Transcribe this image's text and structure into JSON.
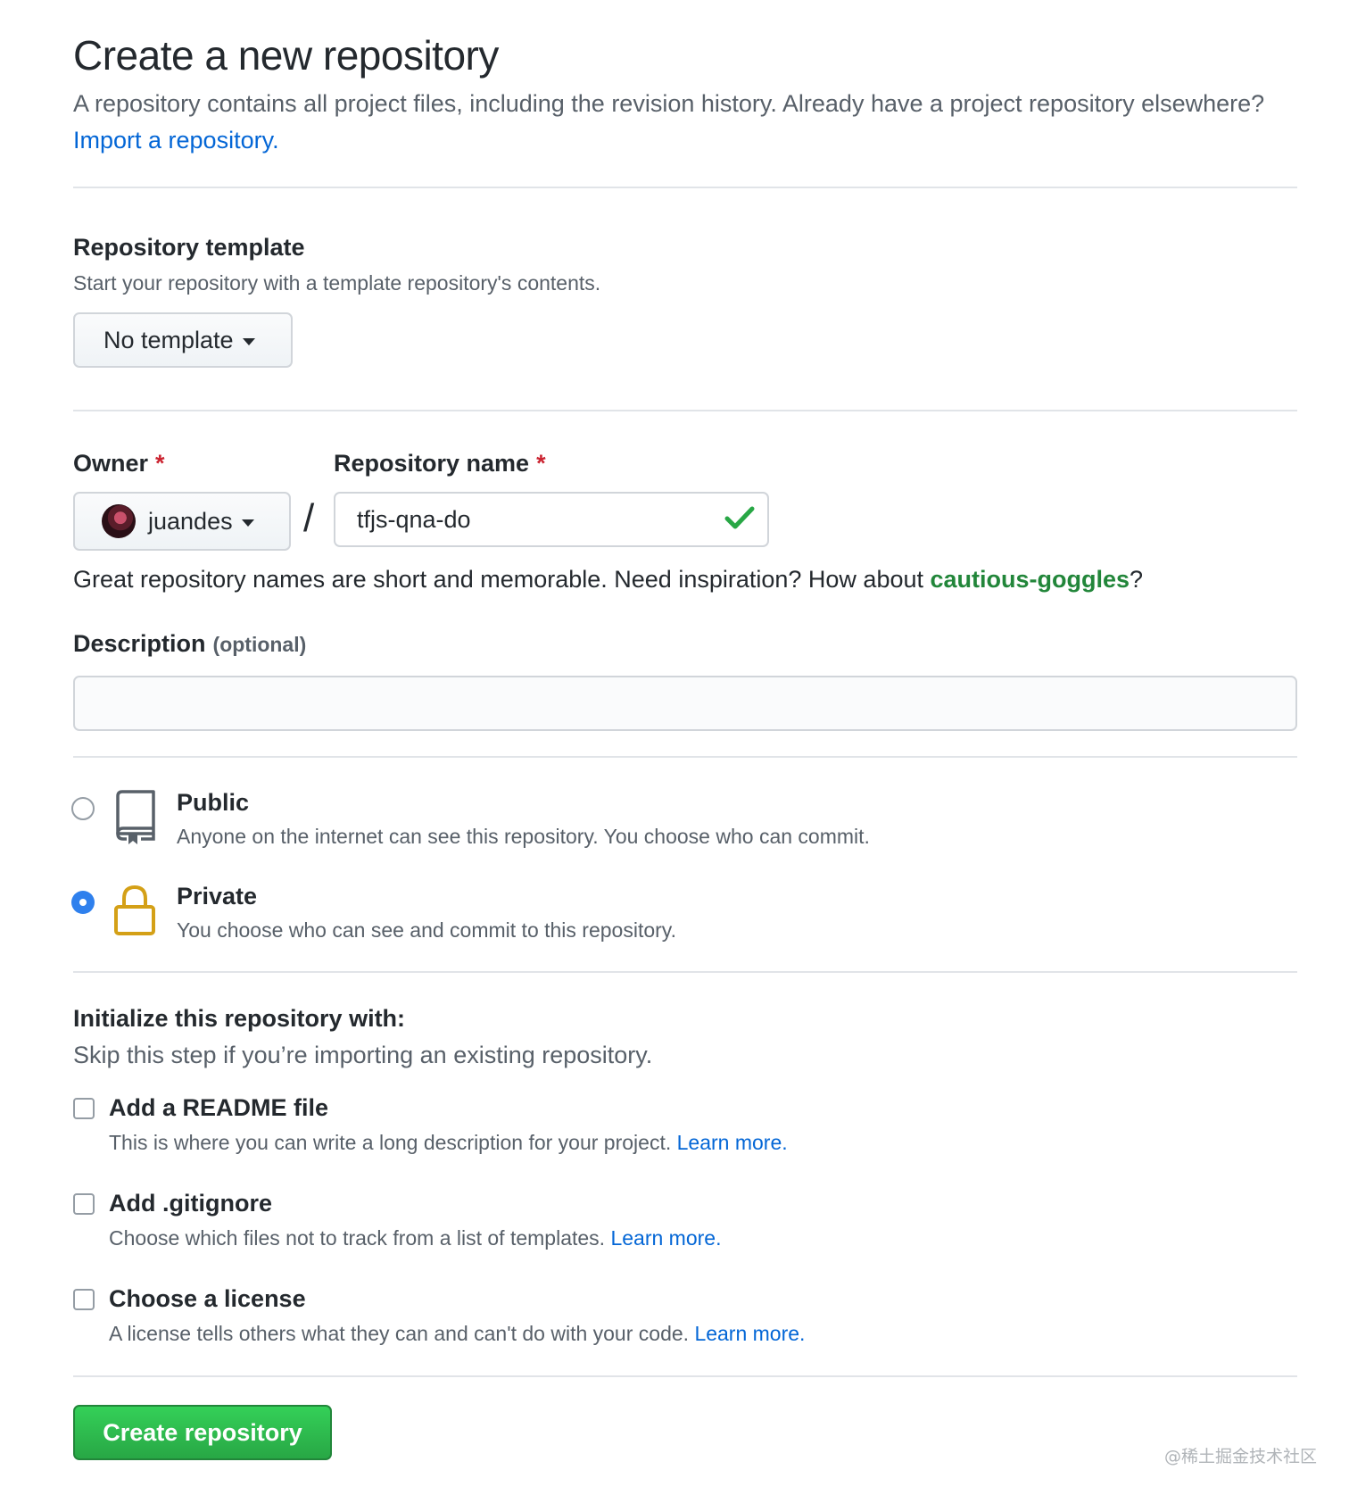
{
  "header": {
    "title": "Create a new repository",
    "subtitle_text": "A repository contains all project files, including the revision history. Already have a project repository elsewhere?",
    "import_link": "Import a repository."
  },
  "template": {
    "heading": "Repository template",
    "note": "Start your repository with a template repository's contents.",
    "button_label": "No template"
  },
  "owner": {
    "label": "Owner",
    "required_mark": "*",
    "value": "juandes"
  },
  "repo_name": {
    "label": "Repository name",
    "required_mark": "*",
    "slash": "/",
    "value": "tfjs-qna-do",
    "valid_icon": "check-icon",
    "valid_color": "#28a745"
  },
  "name_hint": {
    "text": "Great repository names are short and memorable. Need inspiration? How about",
    "suggestion": "cautious-goggles",
    "suffix": "?"
  },
  "description": {
    "label": "Description",
    "optional": "(optional)",
    "value": ""
  },
  "visibility": {
    "options": [
      {
        "title": "Public",
        "description": "Anyone on the internet can see this repository. You choose who can commit.",
        "icon": "repo-icon",
        "selected": false
      },
      {
        "title": "Private",
        "description": "You choose who can see and commit to this repository.",
        "icon": "lock-icon",
        "selected": true
      }
    ]
  },
  "initialize": {
    "heading": "Initialize this repository with:",
    "note": "Skip this step if you’re importing an existing repository.",
    "options": [
      {
        "title": "Add a README file",
        "description": "This is where you can write a long description for your project.",
        "learn_more": "Learn more.",
        "checked": false
      },
      {
        "title": "Add .gitignore",
        "description": "Choose which files not to track from a list of templates.",
        "learn_more": "Learn more.",
        "checked": false
      },
      {
        "title": "Choose a license",
        "description": "A license tells others what they can and can't do with your code.",
        "learn_more": "Learn more.",
        "checked": false
      }
    ]
  },
  "submit": {
    "label": "Create repository",
    "color": "#2ea44f"
  },
  "watermark": "@稀土掘金技术社区",
  "colors": {
    "link": "#0366d6",
    "accent_green": "#22863a",
    "required_red": "#cb2431",
    "lock_icon": "#d4a017",
    "radio_selected": "#2f80ed"
  }
}
